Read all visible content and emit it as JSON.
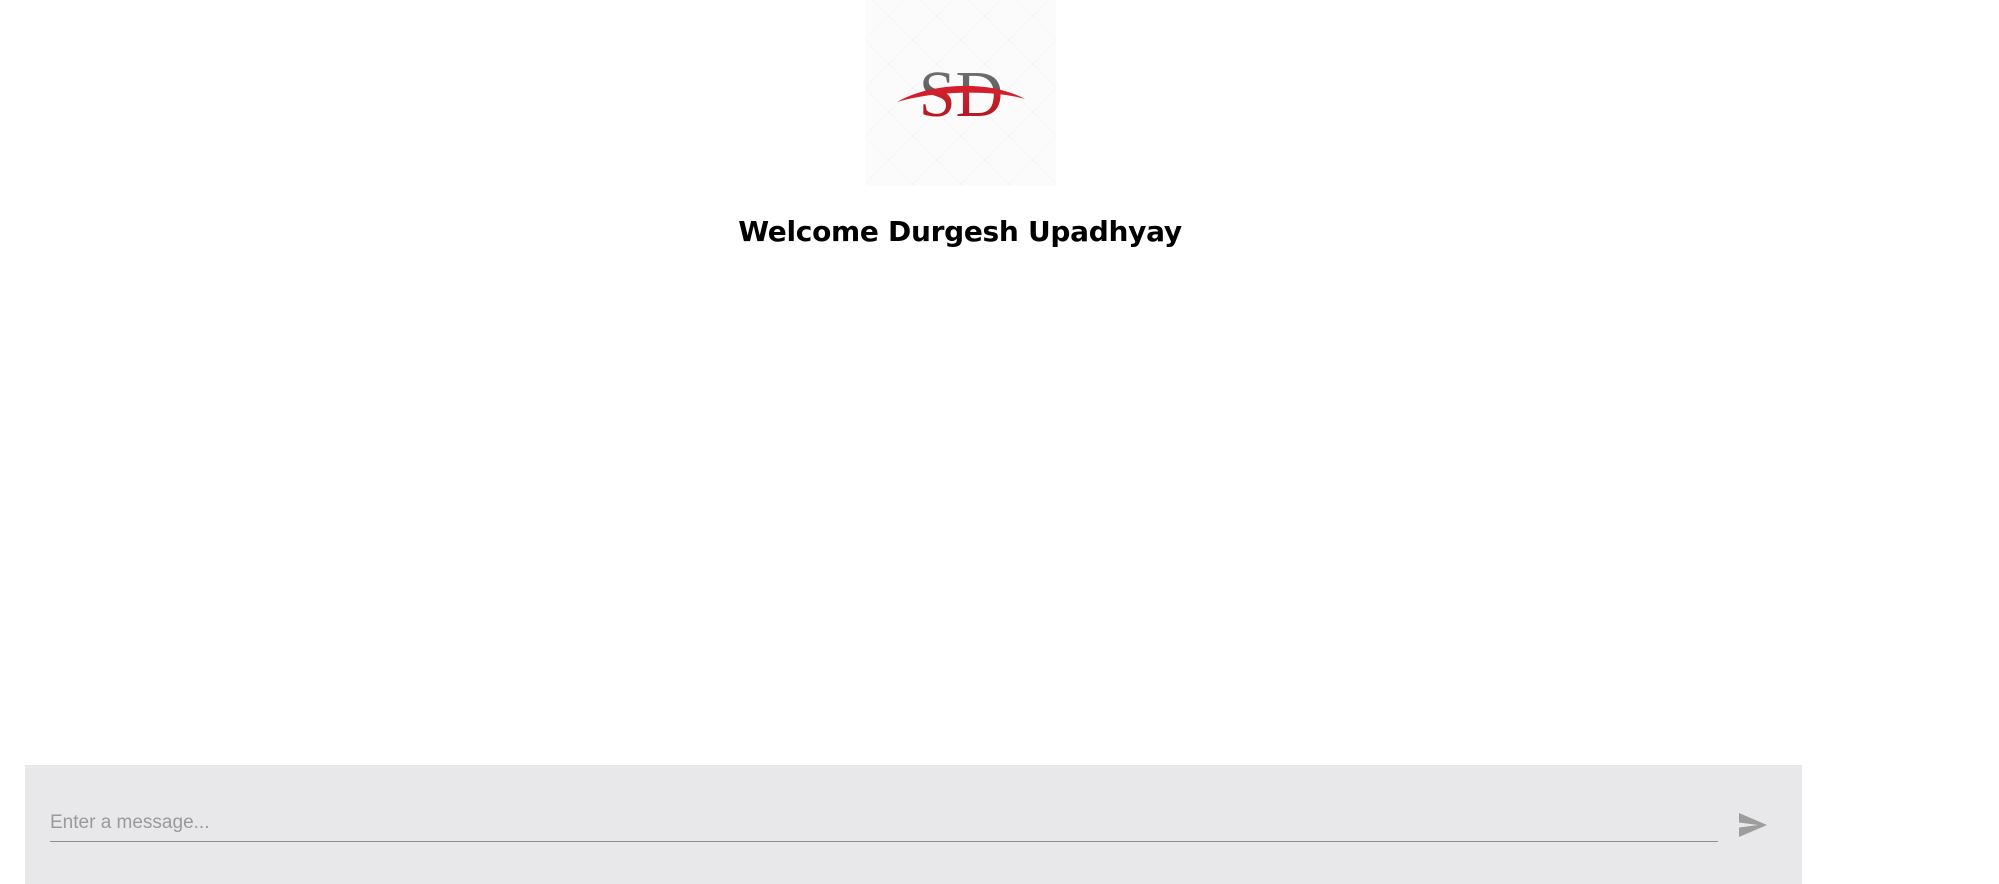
{
  "logo": {
    "text": "SD",
    "colors": {
      "letters": "#5a5a5a",
      "swoosh": "#d21f2b"
    }
  },
  "header": {
    "welcome": "Welcome Durgesh Upadhyay"
  },
  "composer": {
    "placeholder": "Enter a message...",
    "value": "",
    "send_icon": "send-icon",
    "background": "#e8e8ea"
  }
}
